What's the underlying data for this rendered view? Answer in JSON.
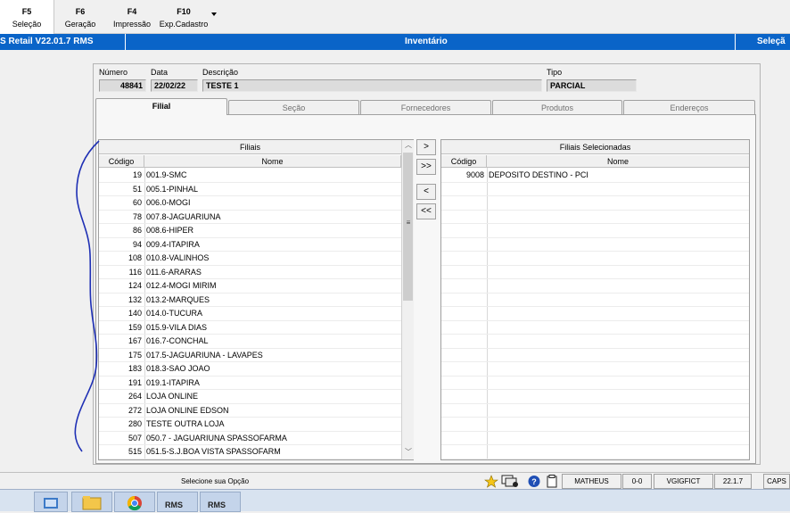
{
  "toolbar": {
    "buttons": [
      {
        "key": "F5",
        "label": "Seleção"
      },
      {
        "key": "F6",
        "label": "Geração"
      },
      {
        "key": "F4",
        "label": "Impressão"
      },
      {
        "key": "F10",
        "label": "Exp.Cadastro"
      }
    ]
  },
  "titlebar": {
    "app": "S Retail V22.01.7 RMS",
    "title": "Inventário",
    "right": "Seleçã"
  },
  "header": {
    "numero_label": "Número",
    "numero_value": "48841",
    "data_label": "Data",
    "data_value": "22/02/22",
    "descricao_label": "Descrição",
    "descricao_value": "TESTE 1",
    "tipo_label": "Tipo",
    "tipo_value": "PARCIAL"
  },
  "tabs": [
    "Filial",
    "Seção",
    "Fornecedores",
    "Produtos",
    "Endereços"
  ],
  "left_grid": {
    "title": "Filiais",
    "col_codigo": "Código",
    "col_nome": "Nome",
    "rows": [
      {
        "codigo": "19",
        "nome": "001.9-SMC"
      },
      {
        "codigo": "51",
        "nome": "005.1-PINHAL"
      },
      {
        "codigo": "60",
        "nome": "006.0-MOGI"
      },
      {
        "codigo": "78",
        "nome": "007.8-JAGUARIUNA"
      },
      {
        "codigo": "86",
        "nome": "008.6-HIPER"
      },
      {
        "codigo": "94",
        "nome": "009.4-ITAPIRA"
      },
      {
        "codigo": "108",
        "nome": "010.8-VALINHOS"
      },
      {
        "codigo": "116",
        "nome": "011.6-ARARAS"
      },
      {
        "codigo": "124",
        "nome": "012.4-MOGI MIRIM"
      },
      {
        "codigo": "132",
        "nome": "013.2-MARQUES"
      },
      {
        "codigo": "140",
        "nome": "014.0-TUCURA"
      },
      {
        "codigo": "159",
        "nome": "015.9-VILA DIAS"
      },
      {
        "codigo": "167",
        "nome": "016.7-CONCHAL"
      },
      {
        "codigo": "175",
        "nome": "017.5-JAGUARIUNA - LAVAPES"
      },
      {
        "codigo": "183",
        "nome": "018.3-SAO JOAO"
      },
      {
        "codigo": "191",
        "nome": "019.1-ITAPIRA"
      },
      {
        "codigo": "264",
        "nome": "LOJA ONLINE"
      },
      {
        "codigo": "272",
        "nome": "LOJA ONLINE EDSON"
      },
      {
        "codigo": "280",
        "nome": "TESTE OUTRA LOJA"
      },
      {
        "codigo": "507",
        "nome": "050.7 - JAGUARIUNA SPASSOFARMA"
      },
      {
        "codigo": "515",
        "nome": "051.5-S.J.BOA VISTA SPASSOFARM"
      }
    ]
  },
  "right_grid": {
    "title": "Filiais Selecionadas",
    "col_codigo": "Código",
    "col_nome": "Nome",
    "rows": [
      {
        "codigo": "9008",
        "nome": "DEPOSITO DESTINO - PCI"
      }
    ]
  },
  "move_buttons": [
    ">",
    ">>",
    "<",
    "<<"
  ],
  "scrollbar": {
    "up": "︿",
    "down": "﹀",
    "grip": "≡"
  },
  "statusbar": {
    "message": "Selecione sua Opção",
    "user": "MATHEUS",
    "code": "0-0",
    "db": "VGIGFICT",
    "version": "22.1.7",
    "caps": "CAPS"
  },
  "taskbar": {
    "items": [
      "RMS",
      "RMS"
    ]
  },
  "annotation_color": "#1e2fb4"
}
